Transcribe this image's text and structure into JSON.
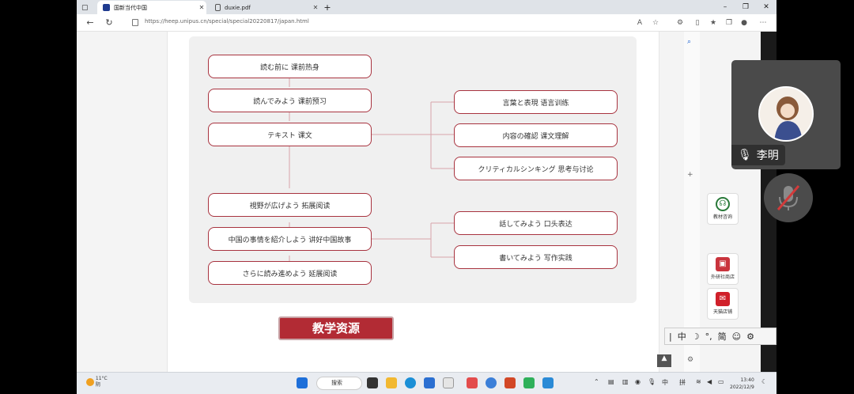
{
  "browser": {
    "tabs": [
      {
        "title": "国新当代中国",
        "active": true
      },
      {
        "title": "duxie.pdf",
        "active": false
      }
    ],
    "new_tab": "+",
    "url": "https://heep.unipus.cn/special/special20220817/japan.html",
    "window": {
      "min": "–",
      "max": "❐",
      "close": "✕"
    }
  },
  "flowchart": {
    "left_nodes": [
      "読む前に 课前热身",
      "読んでみよう 课前预习",
      "テキスト 课文",
      "視野が広げよう 拓展阅读",
      "中国の事情を紹介しよう 讲好中国故事",
      "さらに読み進めよう 延展阅读"
    ],
    "right_group_1": [
      "言葉と表現 语言训练",
      "内容の確認 课文理解",
      "クリティカルシンキング 思考与讨论"
    ],
    "right_group_2": [
      "話してみよう 口头表达",
      "書いてみよう 写作实践"
    ]
  },
  "resources_button": "教学资源",
  "side_widgets": [
    {
      "label": "教材咨询",
      "icon": "headset-icon"
    },
    {
      "label": "外研社商店",
      "icon": "shop-icon"
    },
    {
      "label": "天猫店铺",
      "icon": "tmall-icon"
    }
  ],
  "ime": {
    "items": [
      "中",
      "☽",
      "°,",
      "简",
      "☺",
      "⚙"
    ]
  },
  "call": {
    "participant": "李明"
  },
  "taskbar": {
    "weather_temp": "11°C",
    "weather_desc": "阴",
    "search": "搜索",
    "tray_lang": "中",
    "tray_input": "拼",
    "time": "13:40",
    "date": "2022/12/9"
  },
  "colors": {
    "accent": "#a8333f",
    "resource_bg": "#b22b34"
  }
}
